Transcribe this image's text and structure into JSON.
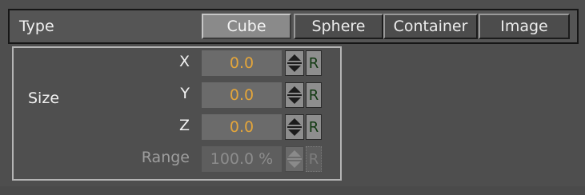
{
  "type_row": {
    "label": "Type",
    "options": [
      "Cube",
      "Sphere",
      "Container",
      "Image"
    ],
    "selected": "Cube"
  },
  "size_group": {
    "label": "Size",
    "rows": [
      {
        "axis": "X",
        "value": "0.0",
        "reset": "R"
      },
      {
        "axis": "Y",
        "value": "0.0",
        "reset": "R"
      },
      {
        "axis": "Z",
        "value": "0.0",
        "reset": "R"
      },
      {
        "axis": "Range",
        "value": "100.0 %",
        "reset": "R",
        "disabled": true
      }
    ]
  },
  "colors": {
    "panel": "#4e4e4e",
    "value_text": "#e3a53b",
    "active_button": "#8a8a8a",
    "reset_text": "#123912"
  },
  "icons": {
    "spinner": "up-down-arrows-icon"
  }
}
